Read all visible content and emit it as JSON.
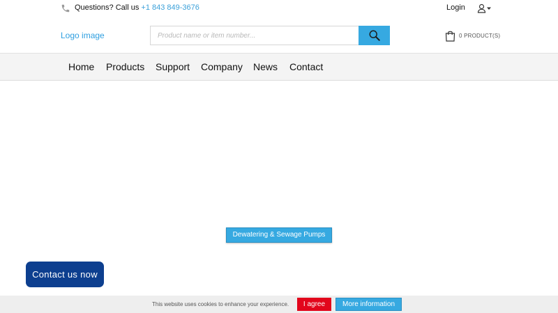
{
  "topbar": {
    "question": "Questions? Call us",
    "phone": "+1 843 849-3676",
    "login": "Login"
  },
  "header": {
    "logo_alt": "Logo image",
    "search_placeholder": "Product name or item number...",
    "cart_label": "0 PRODUCT(S)"
  },
  "nav": {
    "items": [
      "Home",
      "Products",
      "Support",
      "Company",
      "News",
      "Contact"
    ]
  },
  "main": {
    "category_button": "Dewatering & Sewage Pumps"
  },
  "contact_widget": {
    "label": "Contact us now"
  },
  "cookie_banner": {
    "text": "This website uses cookies to enhance your experience.",
    "agree": "I agree",
    "more_info": "More information"
  },
  "colors": {
    "accent": "#36a9e1",
    "contact": "#0d3f8f",
    "agree": "#e2061c"
  },
  "icons": {
    "phone": "phone-icon",
    "user": "user-icon",
    "search": "search-icon",
    "cart": "shopping-bag-icon"
  }
}
